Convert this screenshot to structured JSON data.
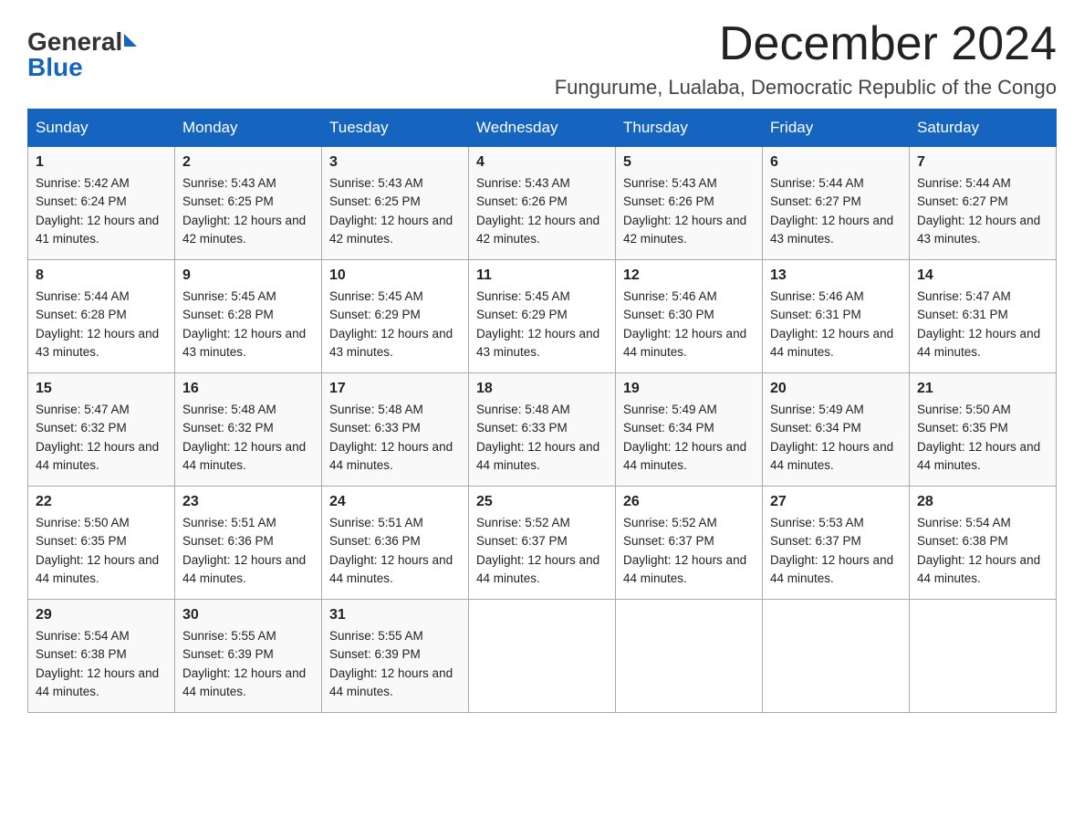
{
  "logo": {
    "general": "General",
    "blue": "Blue"
  },
  "title": "December 2024",
  "location": "Fungurume, Lualaba, Democratic Republic of the Congo",
  "headers": [
    "Sunday",
    "Monday",
    "Tuesday",
    "Wednesday",
    "Thursday",
    "Friday",
    "Saturday"
  ],
  "weeks": [
    [
      {
        "day": "1",
        "sunrise": "5:42 AM",
        "sunset": "6:24 PM",
        "daylight": "12 hours and 41 minutes."
      },
      {
        "day": "2",
        "sunrise": "5:43 AM",
        "sunset": "6:25 PM",
        "daylight": "12 hours and 42 minutes."
      },
      {
        "day": "3",
        "sunrise": "5:43 AM",
        "sunset": "6:25 PM",
        "daylight": "12 hours and 42 minutes."
      },
      {
        "day": "4",
        "sunrise": "5:43 AM",
        "sunset": "6:26 PM",
        "daylight": "12 hours and 42 minutes."
      },
      {
        "day": "5",
        "sunrise": "5:43 AM",
        "sunset": "6:26 PM",
        "daylight": "12 hours and 42 minutes."
      },
      {
        "day": "6",
        "sunrise": "5:44 AM",
        "sunset": "6:27 PM",
        "daylight": "12 hours and 43 minutes."
      },
      {
        "day": "7",
        "sunrise": "5:44 AM",
        "sunset": "6:27 PM",
        "daylight": "12 hours and 43 minutes."
      }
    ],
    [
      {
        "day": "8",
        "sunrise": "5:44 AM",
        "sunset": "6:28 PM",
        "daylight": "12 hours and 43 minutes."
      },
      {
        "day": "9",
        "sunrise": "5:45 AM",
        "sunset": "6:28 PM",
        "daylight": "12 hours and 43 minutes."
      },
      {
        "day": "10",
        "sunrise": "5:45 AM",
        "sunset": "6:29 PM",
        "daylight": "12 hours and 43 minutes."
      },
      {
        "day": "11",
        "sunrise": "5:45 AM",
        "sunset": "6:29 PM",
        "daylight": "12 hours and 43 minutes."
      },
      {
        "day": "12",
        "sunrise": "5:46 AM",
        "sunset": "6:30 PM",
        "daylight": "12 hours and 44 minutes."
      },
      {
        "day": "13",
        "sunrise": "5:46 AM",
        "sunset": "6:31 PM",
        "daylight": "12 hours and 44 minutes."
      },
      {
        "day": "14",
        "sunrise": "5:47 AM",
        "sunset": "6:31 PM",
        "daylight": "12 hours and 44 minutes."
      }
    ],
    [
      {
        "day": "15",
        "sunrise": "5:47 AM",
        "sunset": "6:32 PM",
        "daylight": "12 hours and 44 minutes."
      },
      {
        "day": "16",
        "sunrise": "5:48 AM",
        "sunset": "6:32 PM",
        "daylight": "12 hours and 44 minutes."
      },
      {
        "day": "17",
        "sunrise": "5:48 AM",
        "sunset": "6:33 PM",
        "daylight": "12 hours and 44 minutes."
      },
      {
        "day": "18",
        "sunrise": "5:48 AM",
        "sunset": "6:33 PM",
        "daylight": "12 hours and 44 minutes."
      },
      {
        "day": "19",
        "sunrise": "5:49 AM",
        "sunset": "6:34 PM",
        "daylight": "12 hours and 44 minutes."
      },
      {
        "day": "20",
        "sunrise": "5:49 AM",
        "sunset": "6:34 PM",
        "daylight": "12 hours and 44 minutes."
      },
      {
        "day": "21",
        "sunrise": "5:50 AM",
        "sunset": "6:35 PM",
        "daylight": "12 hours and 44 minutes."
      }
    ],
    [
      {
        "day": "22",
        "sunrise": "5:50 AM",
        "sunset": "6:35 PM",
        "daylight": "12 hours and 44 minutes."
      },
      {
        "day": "23",
        "sunrise": "5:51 AM",
        "sunset": "6:36 PM",
        "daylight": "12 hours and 44 minutes."
      },
      {
        "day": "24",
        "sunrise": "5:51 AM",
        "sunset": "6:36 PM",
        "daylight": "12 hours and 44 minutes."
      },
      {
        "day": "25",
        "sunrise": "5:52 AM",
        "sunset": "6:37 PM",
        "daylight": "12 hours and 44 minutes."
      },
      {
        "day": "26",
        "sunrise": "5:52 AM",
        "sunset": "6:37 PM",
        "daylight": "12 hours and 44 minutes."
      },
      {
        "day": "27",
        "sunrise": "5:53 AM",
        "sunset": "6:37 PM",
        "daylight": "12 hours and 44 minutes."
      },
      {
        "day": "28",
        "sunrise": "5:54 AM",
        "sunset": "6:38 PM",
        "daylight": "12 hours and 44 minutes."
      }
    ],
    [
      {
        "day": "29",
        "sunrise": "5:54 AM",
        "sunset": "6:38 PM",
        "daylight": "12 hours and 44 minutes."
      },
      {
        "day": "30",
        "sunrise": "5:55 AM",
        "sunset": "6:39 PM",
        "daylight": "12 hours and 44 minutes."
      },
      {
        "day": "31",
        "sunrise": "5:55 AM",
        "sunset": "6:39 PM",
        "daylight": "12 hours and 44 minutes."
      },
      null,
      null,
      null,
      null
    ]
  ],
  "sunrise_label": "Sunrise:",
  "sunset_label": "Sunset:",
  "daylight_label": "Daylight:"
}
